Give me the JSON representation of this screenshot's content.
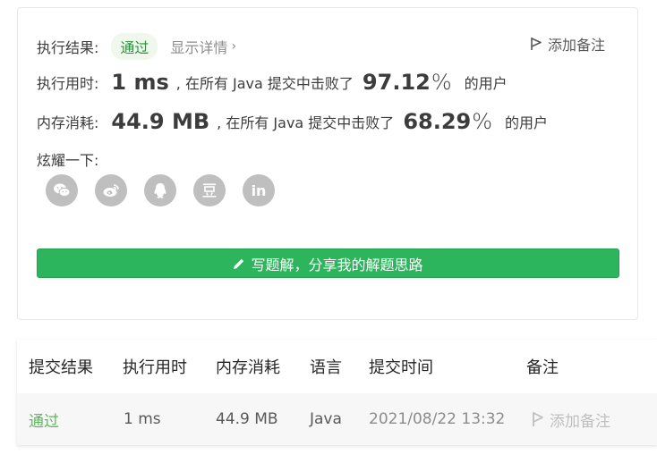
{
  "summary": {
    "result_label": "执行结果:",
    "result_value": "通过",
    "details_label": "显示详情",
    "add_note_label": "添加备注",
    "runtime_label": "执行用时:",
    "runtime_value": "1 ms",
    "runtime_text": ", 在所有 Java 提交中击败了",
    "runtime_percent": "97.12",
    "runtime_percent_sign": "%",
    "runtime_tail": "的用户",
    "memory_label": "内存消耗:",
    "memory_value": "44.9 MB",
    "memory_text": ", 在所有 Java 提交中击败了",
    "memory_percent": "68.29",
    "memory_percent_sign": "%",
    "memory_tail": "的用户",
    "share_label": "炫耀一下:",
    "share_icons": [
      "wechat-icon",
      "weibo-icon",
      "qq-icon",
      "douban-icon",
      "linkedin-icon"
    ],
    "write_button_label": "写题解，分享我的解题思路"
  },
  "table": {
    "headers": [
      "提交结果",
      "执行用时",
      "内存消耗",
      "语言",
      "提交时间",
      "备注"
    ],
    "row": {
      "result": "通过",
      "runtime": "1 ms",
      "memory": "44.9 MB",
      "language": "Java",
      "time": "2021/08/22 13:32",
      "note": "添加备注"
    }
  },
  "colors": {
    "accent_green": "#2db55d",
    "pass_green": "#5cb85c",
    "icon_grey": "#bfbfbf"
  }
}
